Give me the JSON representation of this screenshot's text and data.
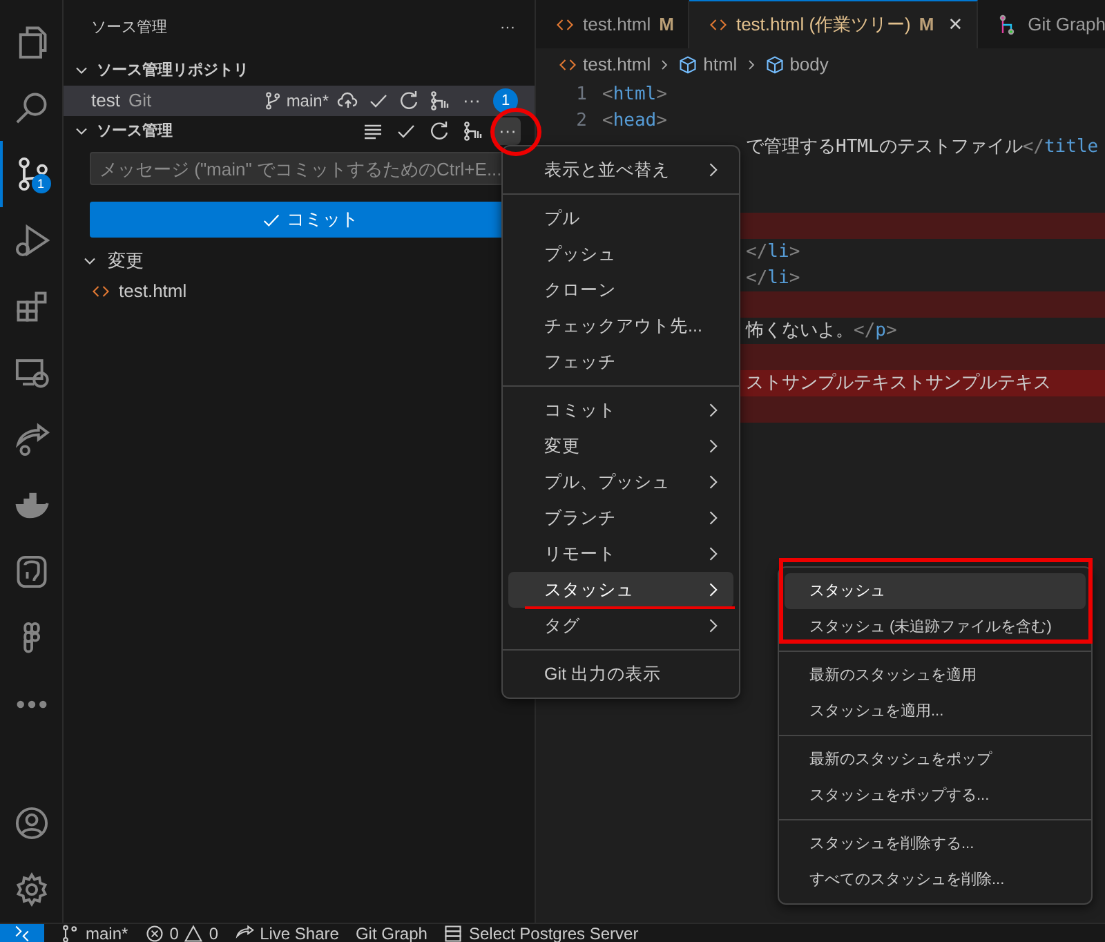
{
  "activity_bar": {
    "items": [
      {
        "selected": false
      },
      {
        "selected": false
      },
      {
        "selected": true,
        "badge": "1"
      },
      {
        "selected": false
      },
      {
        "selected": false
      },
      {
        "selected": false
      },
      {
        "selected": false
      },
      {
        "selected": false
      },
      {
        "selected": false
      },
      {
        "selected": false
      },
      {
        "selected": false
      }
    ],
    "bottom_items": [
      {
        "selected": false
      },
      {
        "selected": false
      }
    ]
  },
  "sidebar": {
    "title": "ソース管理",
    "more": "···",
    "repositories": {
      "title": "ソース管理リポジトリ",
      "expanded": true,
      "items": [
        {
          "name": "test",
          "type": "Git",
          "branch": "main*",
          "more": "···",
          "badge": "1",
          "selected": true
        }
      ]
    },
    "source_control": {
      "title": "ソース管理",
      "expanded": true,
      "more": "···",
      "message": {
        "placeholder": "メッセージ (\"main\" でコミットするためのCtrl+E..."
      },
      "commit_button": "コミット",
      "changes": {
        "title": "変更",
        "expanded": true,
        "files": [
          {
            "name": "test.html"
          }
        ]
      }
    }
  },
  "editor": {
    "tabs": [
      {
        "label": "test.html",
        "status": "M",
        "selected": false,
        "kind": "file"
      },
      {
        "label": "test.html (作業ツリー)",
        "status": "M",
        "selected": true,
        "kind": "file",
        "close": "✕"
      },
      {
        "label": "Git Graph",
        "selected": false,
        "kind": "graph"
      }
    ],
    "breadcrumb": [
      "test.html",
      "html",
      "body"
    ],
    "lines": [
      {
        "number": "1",
        "text": "<html>"
      },
      {
        "number": "2",
        "text": "<head>"
      },
      {
        "text": "で管理するHTMLのテストファイル</title"
      },
      {
        "removed": true
      },
      {
        "text": "</li>"
      },
      {
        "text": "</li>"
      },
      {
        "removed": true
      },
      {
        "text": "怖くないよ。</p>"
      },
      {
        "removed": true
      },
      {
        "text": "ストサンプルテキストサンプルテキス",
        "removed": true
      },
      {
        "removed": true
      }
    ]
  },
  "context_menu": {
    "items": [
      {
        "kind": "item",
        "label": "表示と並べ替え",
        "submenu": true,
        "selected": false
      },
      {
        "kind": "separator"
      },
      {
        "kind": "item",
        "label": "プル",
        "selected": false
      },
      {
        "kind": "item",
        "label": "プッシュ",
        "selected": false
      },
      {
        "kind": "item",
        "label": "クローン",
        "selected": false
      },
      {
        "kind": "item",
        "label": "チェックアウト先...",
        "selected": false
      },
      {
        "kind": "item",
        "label": "フェッチ",
        "selected": false
      },
      {
        "kind": "separator"
      },
      {
        "kind": "item",
        "label": "コミット",
        "submenu": true,
        "selected": false
      },
      {
        "kind": "item",
        "label": "変更",
        "submenu": true,
        "selected": false
      },
      {
        "kind": "item",
        "label": "プル、プッシュ",
        "submenu": true,
        "selected": false
      },
      {
        "kind": "item",
        "label": "ブランチ",
        "submenu": true,
        "selected": false
      },
      {
        "kind": "item",
        "label": "リモート",
        "submenu": true,
        "selected": false
      },
      {
        "kind": "item",
        "label": "スタッシュ",
        "submenu": true,
        "selected": true
      },
      {
        "kind": "item",
        "label": "タグ",
        "submenu": true,
        "selected": false
      },
      {
        "kind": "separator"
      },
      {
        "kind": "item",
        "label": "Git 出力の表示",
        "selected": false
      }
    ]
  },
  "submenu": {
    "items": [
      {
        "kind": "item",
        "label": "スタッシュ",
        "selected": true
      },
      {
        "kind": "item",
        "label": "スタッシュ (未追跡ファイルを含む)",
        "selected": false
      },
      {
        "kind": "separator"
      },
      {
        "kind": "item",
        "label": "最新のスタッシュを適用",
        "selected": false
      },
      {
        "kind": "item",
        "label": "スタッシュを適用...",
        "selected": false
      },
      {
        "kind": "separator"
      },
      {
        "kind": "item",
        "label": "最新のスタッシュをポップ",
        "selected": false
      },
      {
        "kind": "item",
        "label": "スタッシュをポップする...",
        "selected": false
      },
      {
        "kind": "separator"
      },
      {
        "kind": "item",
        "label": "スタッシュを削除する...",
        "selected": false
      },
      {
        "kind": "item",
        "label": "すべてのスタッシュを削除...",
        "selected": false
      }
    ]
  },
  "status_bar": {
    "branch": "main*",
    "errors": "0",
    "warnings": "0",
    "live_share": "Live Share",
    "git_graph": "Git Graph",
    "postgres": "Select Postgres Server"
  }
}
